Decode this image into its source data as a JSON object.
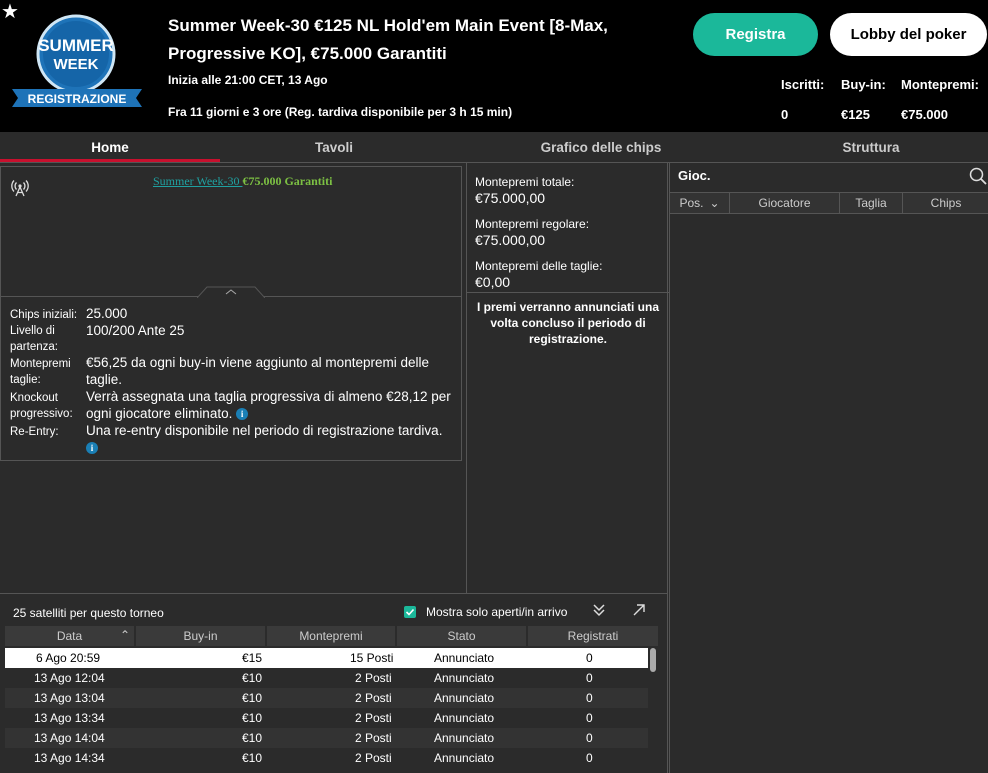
{
  "header": {
    "logo_line1": "SUMMER",
    "logo_line2": "WEEK",
    "logo_banner": "REGISTRAZIONE",
    "title": "Summer Week-30 €125 NL Hold'em Main Event [8-Max, Progressive KO], €75.000 Garantiti",
    "starts": "Inizia alle 21:00 CET, 13 Ago",
    "late_reg": "Fra 11 giorni e 3 ore (Reg. tardiva disponibile per 3 h 15 min)",
    "register_label": "Registra",
    "lobby_label": "Lobby del poker",
    "stats": [
      {
        "label": "Iscritti:",
        "value": "0"
      },
      {
        "label": "Buy-in:",
        "value": "€125"
      },
      {
        "label": "Montepremi:",
        "value": "€75.000"
      }
    ]
  },
  "tabs": [
    "Home",
    "Tavoli",
    "Grafico delle chips",
    "Struttura"
  ],
  "info": {
    "banner_link": "Summer Week-30 ",
    "banner_guarantee": "€75.000 Garantiti",
    "rows": [
      {
        "label": "Chips iniziali:",
        "value": "25.000"
      },
      {
        "label": "Livello di partenza:",
        "value": "100/200 Ante 25"
      },
      {
        "label": "Montepremi taglie:",
        "value": "€56,25 da ogni buy-in viene aggiunto al montepremi delle taglie."
      },
      {
        "label": "Knockout progressivo:",
        "value": "Verrà assegnata una taglia progressiva di almeno €28,12 per ogni giocatore eliminato."
      },
      {
        "label": "Re-Entry:",
        "value": "Una re-entry disponibile nel periodo di registrazione tardiva."
      }
    ]
  },
  "prize": {
    "total_label": "Montepremi totale:",
    "total_value": "€75.000,00",
    "regular_label": "Montepremi regolare:",
    "regular_value": "€75.000,00",
    "bounty_label": "Montepremi delle taglie:",
    "bounty_value": "€0,00",
    "note": "I premi verranno annunciati una volta concluso il periodo di registrazione."
  },
  "players": {
    "title": "Gioc.",
    "columns": [
      "Pos.",
      "Giocatore",
      "Taglia",
      "Chips"
    ]
  },
  "satellites": {
    "count_text": "25 satelliti per questo torneo",
    "filter_label": "Mostra solo aperti/in arrivo",
    "columns": [
      "Data",
      "Buy-in",
      "Montepremi",
      "Stato",
      "Registrati"
    ],
    "rows": [
      {
        "date": "6 Ago  20:59",
        "buyin": "€15",
        "prize": "15 Posti",
        "status": "Annunciato",
        "reg": "0"
      },
      {
        "date": "13 Ago  12:04",
        "buyin": "€10",
        "prize": "2 Posti",
        "status": "Annunciato",
        "reg": "0"
      },
      {
        "date": "13 Ago  13:04",
        "buyin": "€10",
        "prize": "2 Posti",
        "status": "Annunciato",
        "reg": "0"
      },
      {
        "date": "13 Ago  13:34",
        "buyin": "€10",
        "prize": "2 Posti",
        "status": "Annunciato",
        "reg": "0"
      },
      {
        "date": "13 Ago  14:04",
        "buyin": "€10",
        "prize": "2 Posti",
        "status": "Annunciato",
        "reg": "0"
      },
      {
        "date": "13 Ago  14:34",
        "buyin": "€10",
        "prize": "2 Posti",
        "status": "Annunciato",
        "reg": "0"
      }
    ]
  },
  "colors": {
    "accent": "#1bb89a",
    "tab_active": "#c8102e",
    "logo_blue": "#1e73b8"
  }
}
